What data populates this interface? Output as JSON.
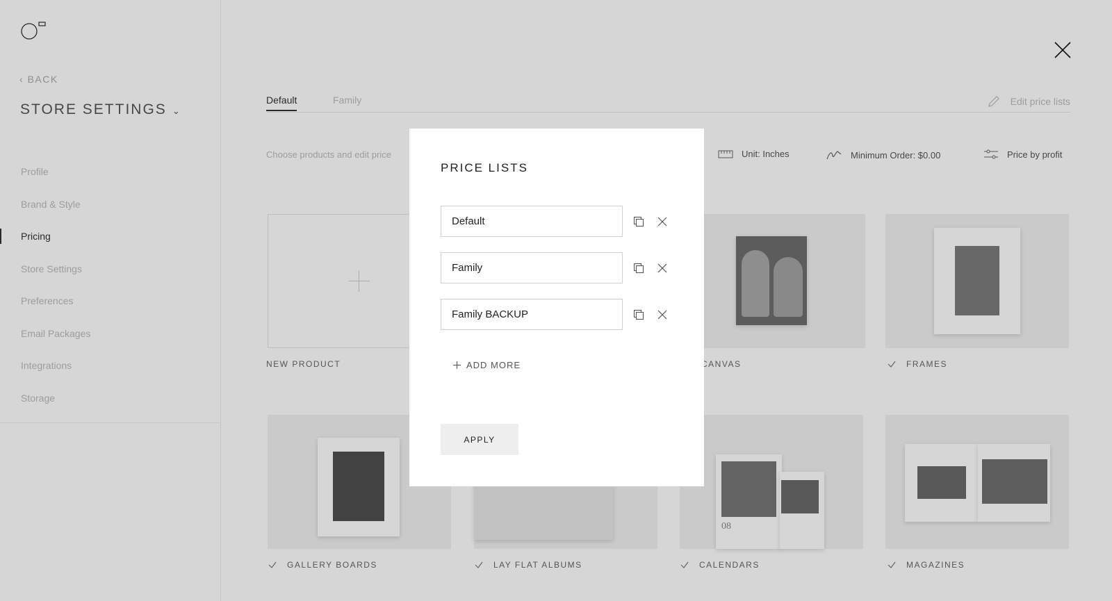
{
  "sidebar": {
    "back_label": "BACK",
    "store_title": "STORE SETTINGS",
    "items": [
      {
        "label": "Profile"
      },
      {
        "label": "Brand & Style"
      },
      {
        "label": "Pricing"
      },
      {
        "label": "Store Settings"
      },
      {
        "label": "Preferences"
      },
      {
        "label": "Email Packages"
      },
      {
        "label": "Integrations"
      },
      {
        "label": "Storage"
      }
    ],
    "active_item": "Pricing"
  },
  "header": {
    "tabs": [
      {
        "label": "Default"
      },
      {
        "label": "Family"
      }
    ],
    "active_tab": "Default",
    "edit_price_lists": "Edit price lists"
  },
  "toolbar": {
    "description": "Choose products and edit price",
    "unit": "Unit: Inches",
    "minimum_order": "Minimum Order: $0.00",
    "price_by_profit": "Price by profit"
  },
  "products": [
    {
      "label": "NEW PRODUCT",
      "checked": false
    },
    {
      "label": "CANVAS",
      "checked": true
    },
    {
      "label": "FRAMES",
      "checked": true
    },
    {
      "label": "GALLERY BOARDS",
      "checked": true
    },
    {
      "label": "LAY FLAT ALBUMS",
      "checked": true
    },
    {
      "label": "CALENDARS",
      "checked": true
    },
    {
      "label": "MAGAZINES",
      "checked": true
    }
  ],
  "modal": {
    "title": "PRICE LISTS",
    "price_lists": [
      {
        "value": "Default"
      },
      {
        "value": "Family"
      },
      {
        "value": "Family BACKUP"
      }
    ],
    "add_more_label": "ADD MORE",
    "apply_label": "APPLY"
  },
  "calendar_number": "08",
  "colors": {
    "overlay": "#000000",
    "modal_bg": "#ffffff",
    "apply_bg": "#eeeeee",
    "text_dark": "#222222",
    "muted": "#bbbbbb"
  }
}
